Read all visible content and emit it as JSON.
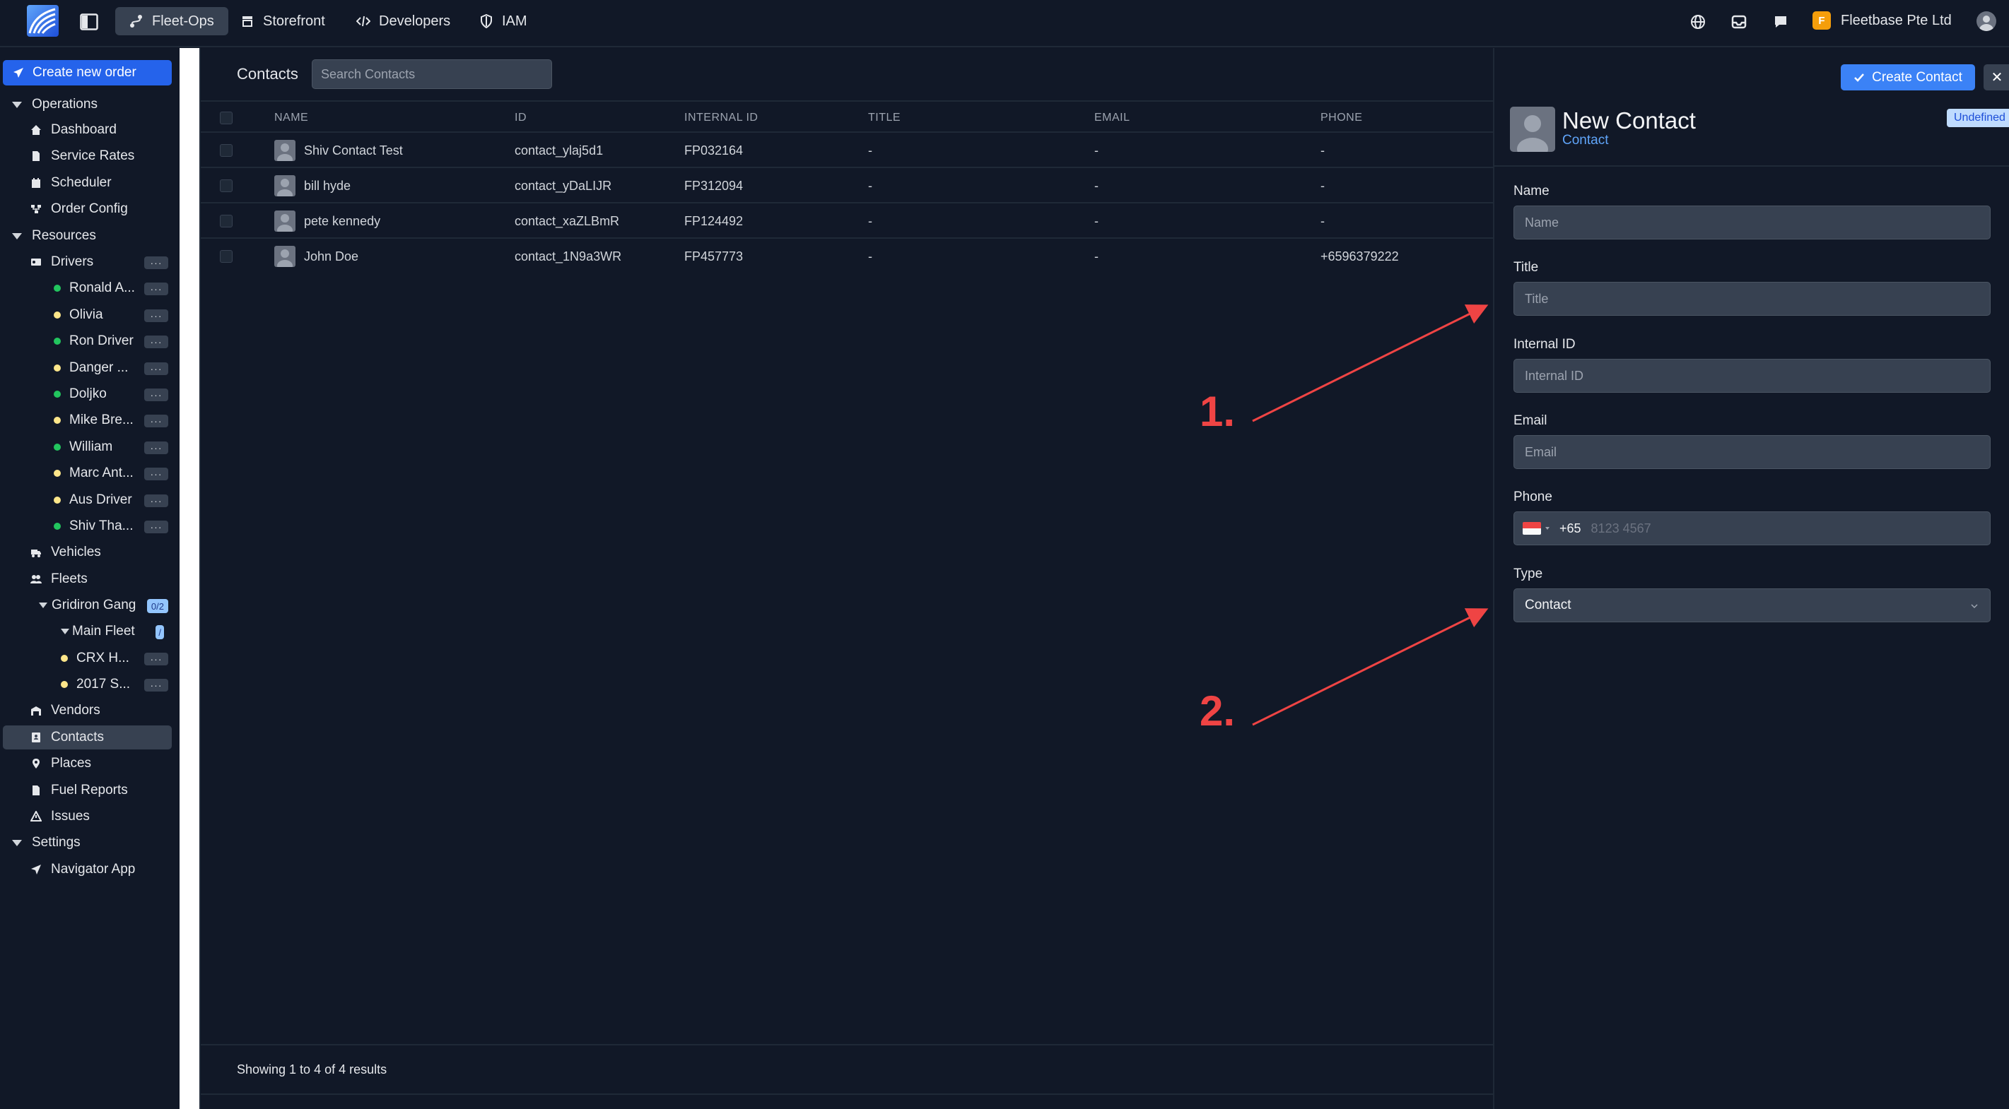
{
  "topbar": {
    "tabs": [
      {
        "label": "Fleet-Ops",
        "icon": "route-icon",
        "active": true
      },
      {
        "label": "Storefront",
        "icon": "store-icon",
        "active": false
      },
      {
        "label": "Developers",
        "icon": "code-icon",
        "active": false
      },
      {
        "label": "IAM",
        "icon": "shield-icon",
        "active": false
      }
    ],
    "org_initial": "F",
    "org_name": "Fleetbase Pte Ltd"
  },
  "sidebar": {
    "create_order": "Create new order",
    "sections": {
      "operations": "Operations",
      "resources": "Resources",
      "settings": "Settings"
    },
    "operations": [
      "Dashboard",
      "Service Rates",
      "Scheduler",
      "Order Config"
    ],
    "drivers_label": "Drivers",
    "drivers": [
      {
        "name": "Ronald A...",
        "status": "online"
      },
      {
        "name": "Olivia",
        "status": "offline"
      },
      {
        "name": "Ron Driver",
        "status": "online"
      },
      {
        "name": "Danger ...",
        "status": "offline"
      },
      {
        "name": "Doljko",
        "status": "online"
      },
      {
        "name": "Mike Bre...",
        "status": "offline"
      },
      {
        "name": "William",
        "status": "online"
      },
      {
        "name": "Marc Ant...",
        "status": "offline"
      },
      {
        "name": "Aus Driver",
        "status": "offline"
      },
      {
        "name": "Shiv Tha...",
        "status": "online"
      }
    ],
    "vehicles": "Vehicles",
    "fleets": "Fleets",
    "fleet_group": {
      "name": "Gridiron Gang",
      "count": "0/2"
    },
    "sub_fleet": {
      "name": "Main Fleet",
      "count": "/"
    },
    "fleet_vehicles": [
      "CRX H...",
      "2017 S..."
    ],
    "more_resources": [
      "Vendors",
      "Contacts",
      "Places",
      "Fuel Reports",
      "Issues"
    ],
    "settings_items": [
      "Navigator App"
    ],
    "dots": "···"
  },
  "main": {
    "title": "Contacts",
    "search_placeholder": "Search Contacts",
    "columns": [
      "NAME",
      "ID",
      "INTERNAL ID",
      "TITLE",
      "EMAIL",
      "PHONE"
    ],
    "rows": [
      {
        "name": "Shiv Contact Test",
        "id": "contact_ylaj5d1",
        "internal_id": "FP032164",
        "title": "-",
        "email": "-",
        "phone": "-"
      },
      {
        "name": "bill hyde",
        "id": "contact_yDaLIJR",
        "internal_id": "FP312094",
        "title": "-",
        "email": "-",
        "phone": "-"
      },
      {
        "name": "pete kennedy",
        "id": "contact_xaZLBmR",
        "internal_id": "FP124492",
        "title": "-",
        "email": "-",
        "phone": "-"
      },
      {
        "name": "John Doe",
        "id": "contact_1N9a3WR",
        "internal_id": "FP457773",
        "title": "-",
        "email": "-",
        "phone": "+6596379222"
      }
    ],
    "footer": "Showing 1 to 4 of 4 results"
  },
  "annotations": [
    "1.",
    "2."
  ],
  "panel": {
    "create_button": "Create Contact",
    "close_glyph": "✕",
    "title": "New Contact",
    "subtitle": "Contact",
    "badge": "Undefined",
    "fields": [
      {
        "label": "Name",
        "placeholder": "Name"
      },
      {
        "label": "Title",
        "placeholder": "Title"
      },
      {
        "label": "Internal ID",
        "placeholder": "Internal ID"
      },
      {
        "label": "Email",
        "placeholder": "Email"
      }
    ],
    "phone": {
      "label": "Phone",
      "dial_code": "+65",
      "placeholder": "8123 4567"
    },
    "type": {
      "label": "Type",
      "value": "Contact"
    }
  },
  "colors": {
    "accent": "#3b82f6",
    "annotation": "#ef4444",
    "online": "#22c55e",
    "offline": "#fde68a"
  }
}
